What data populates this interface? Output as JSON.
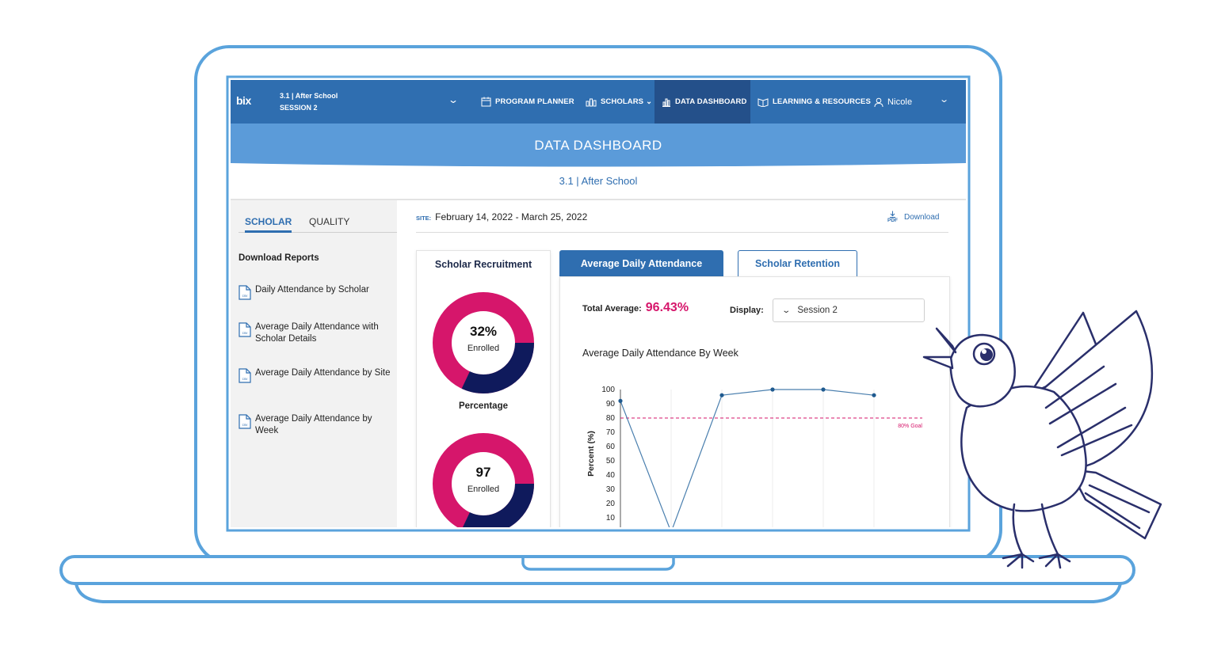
{
  "nav": {
    "logo": "bix",
    "program_line1": "3.1 | After School",
    "program_line2": "SESSION 2",
    "items": [
      {
        "label": "PROGRAM PLANNER",
        "icon": "calendar-icon"
      },
      {
        "label": "SCHOLARS",
        "icon": "scholars-icon",
        "caret": "⌄"
      },
      {
        "label": "DATA DASHBOARD",
        "icon": "bar-chart-icon",
        "active": true
      },
      {
        "label": "LEARNING & RESOURCES",
        "icon": "book-icon"
      }
    ],
    "user": "Nicole"
  },
  "banner": {
    "title": "DATA DASHBOARD",
    "color": "#5b9bd9"
  },
  "subtitle": "3.1 | After School",
  "sidebar": {
    "tabs": [
      {
        "label": "SCHOLAR",
        "active": true
      },
      {
        "label": "QUALITY",
        "active": false
      }
    ],
    "download_title": "Download Reports",
    "reports": [
      {
        "label": "Daily Attendance by Scholar"
      },
      {
        "label": "Average Daily Attendance with Scholar Details"
      },
      {
        "label": "Average Daily Attendance by Site"
      },
      {
        "label": "Average Daily Attendance by Week"
      }
    ],
    "file_badge": "csv"
  },
  "site": {
    "label": "SITE:",
    "dates": "February 14, 2022 - March 25, 2022"
  },
  "download": {
    "badge": "PDF",
    "label": "Download"
  },
  "recruitment": {
    "title": "Scholar Recruitment",
    "donuts": [
      {
        "value": "32%",
        "label": "Enrolled",
        "fraction": 0.32
      },
      {
        "value": "97",
        "label": "Enrolled",
        "fraction": 0.32
      }
    ],
    "percentage_label": "Percentage"
  },
  "tabs": {
    "active": "Average Daily Attendance",
    "inactive": "Scholar Retention"
  },
  "attendance": {
    "total_label": "Total Average:",
    "total_value": "96.43%",
    "display_label": "Display:",
    "display_value": "Session 2",
    "chart_title": "Average Daily Attendance By Week"
  },
  "colors": {
    "primary": "#2f6eb0",
    "accent": "#d6166b",
    "navy": "#0f1a5c",
    "line": "#4a7fae"
  },
  "chart_data": {
    "type": "line",
    "ylabel": "Percent (%)",
    "ylim": [
      0,
      100
    ],
    "yticks": [
      100,
      90,
      80,
      70,
      60,
      50,
      40,
      30,
      20,
      10
    ],
    "series": [
      {
        "values": [
          92,
          0,
          96,
          100,
          100,
          96
        ]
      }
    ],
    "goal": {
      "value": 80,
      "label": "80% Goal"
    },
    "grid": "vertical"
  }
}
